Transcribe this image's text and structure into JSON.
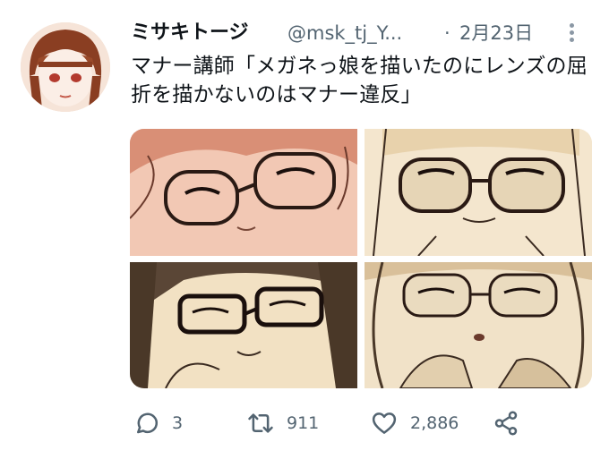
{
  "tweet": {
    "author_name": "ミサキトージ",
    "handle": "@msk_tj_Y...",
    "separator": "·",
    "date": "2月23日",
    "text": "マナー講師「メガネっ娘を描いたのにレンズの屈折を描かないのはマナー違反」"
  },
  "actions": {
    "reply_count": "3",
    "retweet_count": "911",
    "like_count": "2,886"
  },
  "colors": {
    "secondary_text": "#536471",
    "primary_text": "#0f1419"
  },
  "icons": [
    "avatar",
    "more-dots-icon",
    "reply-icon",
    "retweet-icon",
    "heart-icon",
    "share-icon"
  ]
}
